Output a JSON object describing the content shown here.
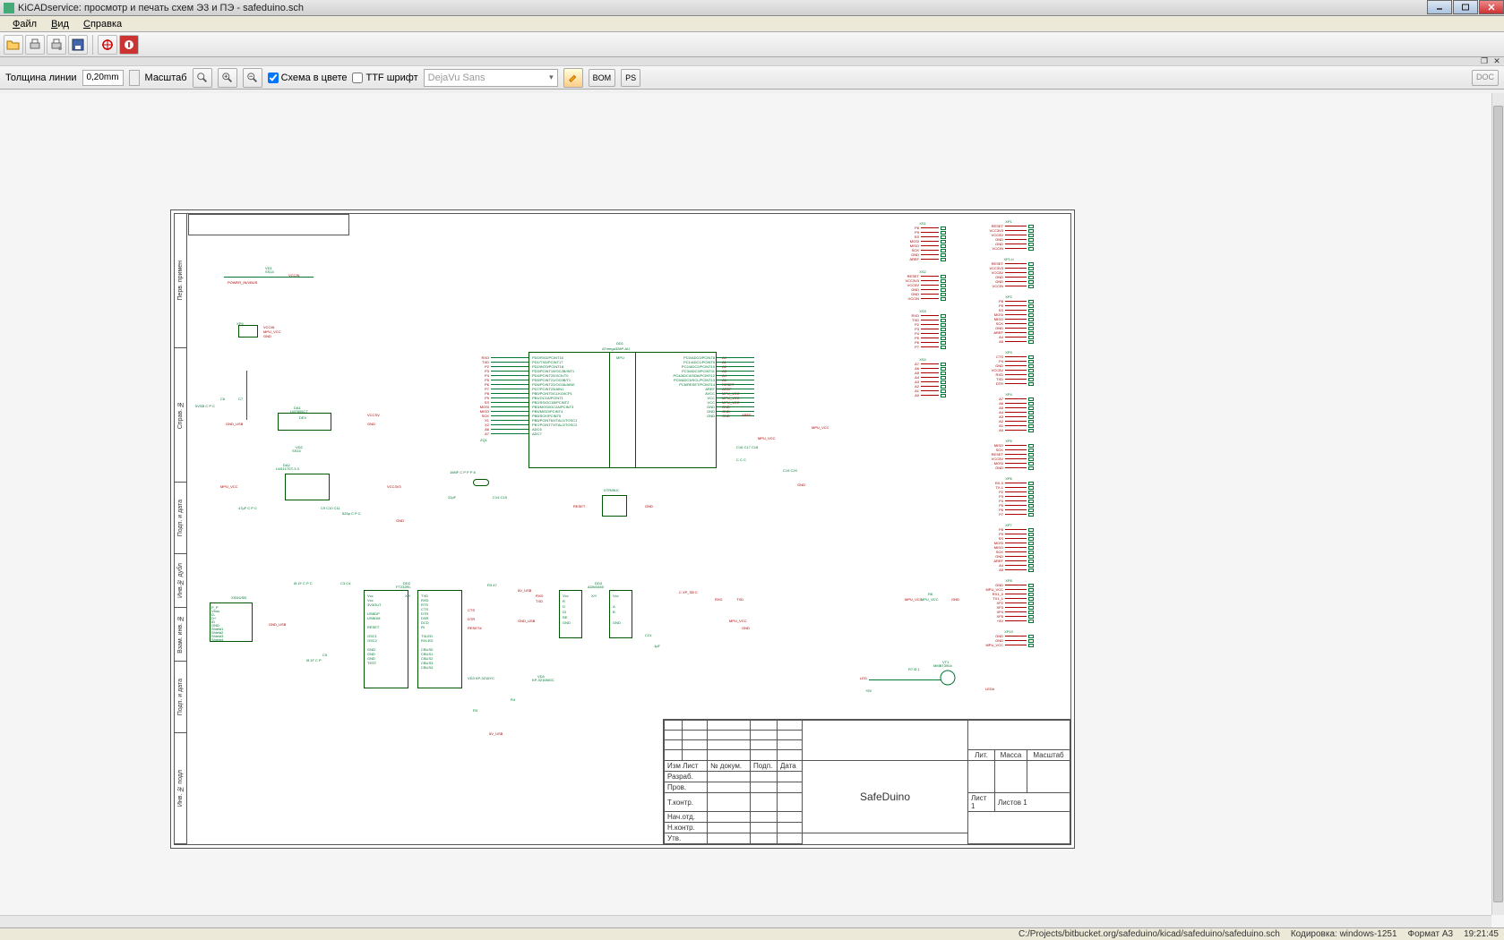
{
  "window": {
    "title": "KiCADservice: просмотр и печать схем Э3 и ПЭ - safeduino.sch"
  },
  "menu": {
    "file": "Файл",
    "view": "Вид",
    "help": "Справка"
  },
  "toolbar": {
    "open": "open",
    "printer1": "print-preview",
    "printer2": "print-setup",
    "save": "save",
    "fit": "zoom-fit",
    "stop": "stop"
  },
  "options": {
    "line_width_label": "Толщина линии",
    "line_width_value": "0,20mm",
    "scale_label": "Масштаб",
    "color_scheme_label": "Схема в цвете",
    "color_scheme_checked": true,
    "ttf_label": "TTF шрифт",
    "ttf_checked": false,
    "font_selected": "DejaVu Sans",
    "bom": "BOM",
    "ps": "PS",
    "doc": "DOC"
  },
  "side_labels": [
    "Перв. примен",
    "Справ. №",
    "Подп. и дата",
    "Инв.№ дубл",
    "Взам. инв. №",
    "Подп. и дата",
    "Инв. № подл"
  ],
  "titleblock": {
    "project": "SafeDuino",
    "cols_top": [
      "Лит.",
      "Масса",
      "Масштаб"
    ],
    "rows_left": [
      "Изм Лист",
      "№ докум.",
      "Подп.",
      "Дата"
    ],
    "rows_bot": [
      "Разраб.",
      "Пров.",
      "Т.контр.",
      "Нач.отд.",
      "Н.контр.",
      "Утв."
    ],
    "sheet": "Лист 1",
    "sheets": "Листов 1"
  },
  "ic_main": {
    "ref": "DD1",
    "value": "ATmega328P-AU",
    "label": "MPU",
    "pins_left": [
      "PD0/RXD/PCINT16",
      "PD1/TXD/PCINT17",
      "PD2/INT0/PCINT18",
      "PD3/PCINT19/OC2B/INT1",
      "PD4/PCINT20/XCK/T0",
      "PD5/PCINT21/OC0B/T1",
      "PD6/PCINT22/OC0A/AIN0",
      "PD7/PCINT23/AIN1",
      "PB0/PCINT0/CLKO/ICP1",
      "PB1/OC1A/PCINT1",
      "PB2/SS/OC1B/PCINT2",
      "PB3/MOSI/OC2A/PCINT3",
      "PB4/MISO/PCINT4",
      "PB5/SCK/PCINT5",
      "PB6/PCINT6/XTAL1/TOSC1",
      "PB7/PCINT7/XTAL2/TOSC2",
      "ADC6",
      "ADC7"
    ],
    "pins_right": [
      "PC0/ADC0/PCINT8",
      "PC1/ADC1/PCINT9",
      "PC2/ADC2/PCINT10",
      "PC3/ADC3/PCINT11",
      "PC4/ADC4/SDA/PCINT12",
      "PC5/ADC5/SCL/PCINT13",
      "PC6/RESET/PCINT14",
      "AREF",
      "AVCC",
      "VCC",
      "VCC",
      "GND",
      "GND",
      "GND"
    ],
    "nets_left": [
      "RXD",
      "TXD",
      "P2",
      "P3",
      "P4",
      "P5",
      "P6",
      "P7",
      "P8",
      "P9",
      "SS",
      "MOSI",
      "MISO",
      "SCK",
      "X1",
      "X2",
      "A6",
      "A7"
    ],
    "nets_right": [
      "A0",
      "A1",
      "A2",
      "A3",
      "A4",
      "A5",
      "RESET",
      "AREF",
      "MPU_VCC",
      "MPU_VCC",
      "MPU_VCC",
      "GND",
      "GND",
      "GND"
    ]
  },
  "ic_usb": {
    "ref": "DD2",
    "value": "FT232RL",
    "label": "X/Y"
  },
  "ic_rs485": {
    "ref": "DD3",
    "value": "ADM3485",
    "label": "X/Y"
  },
  "reg1": {
    "ref": "DA1",
    "value": "LM7805CT",
    "label": "DEV"
  },
  "reg2": {
    "ref": "DA2",
    "value": "LM1117DT-3.3"
  },
  "diode1": {
    "ref": "VD1",
    "value": "SS14"
  },
  "diode2": {
    "ref": "VD2",
    "value": "SS14"
  },
  "led_circuit": {
    "ref": "VT1",
    "value": "MMBT3904",
    "r": "R7 Ø.1",
    "label": "LED",
    "label2": "LED#"
  },
  "status": {
    "path": "C:/Projects/bitbucket.org/safeduino/kicad/safeduino/safeduino.sch",
    "encoding": "Кодировка: windows-1251",
    "format": "Формат A3",
    "time": "19:21:45"
  },
  "headers_right": [
    {
      "ref": "XP1",
      "pins": [
        "RESET",
        "VCC3V3",
        "VCC5V",
        "GND",
        "GND",
        "VCCIN"
      ]
    },
    {
      "ref": "XP1-b",
      "pins": [
        "RESET",
        "VCC3V3",
        "VCC5V",
        "GND",
        "GND",
        "VCCIN"
      ]
    },
    {
      "ref": "XP2",
      "pins": [
        "P8",
        "P9",
        "SS",
        "MOSI",
        "MISO",
        "SCK",
        "GND",
        "AREF",
        "A4",
        "A5"
      ]
    },
    {
      "ref": "XP3",
      "pins": [
        "CTS",
        "P4",
        "GND",
        "VCC5V",
        "RXD",
        "TXD",
        "DTR"
      ]
    },
    {
      "ref": "XP4",
      "pins": [
        "A7",
        "A6",
        "A5",
        "A4",
        "A3",
        "A2",
        "A1",
        "A0"
      ]
    },
    {
      "ref": "XP5",
      "pins": [
        "MISO",
        "SCK",
        "RESET",
        "VCC5V",
        "MOSI",
        "GND"
      ]
    },
    {
      "ref": "XP6",
      "pins": [
        "RX-0",
        "TX-1",
        "P2",
        "P3",
        "P4",
        "P5",
        "P6",
        "P7"
      ]
    },
    {
      "ref": "XP7",
      "pins": [
        "P8",
        "P9",
        "SS",
        "MOSI",
        "MISO",
        "SCK",
        "GND",
        "AREF",
        "A4",
        "A5"
      ]
    },
    {
      "ref": "XP8",
      "pins": [
        "GND",
        "MPU_VCC",
        "RX1_0",
        "TX1_1",
        "XP2",
        "XP3",
        "XP4",
        "XP5",
        "+5V"
      ]
    },
    {
      "ref": "XP10",
      "pins": [
        "GND",
        "GND",
        "MPU_VCC"
      ]
    }
  ],
  "headers_mid": [
    {
      "ref": "XS1",
      "pins": [
        "P8",
        "P9",
        "SS",
        "MOSI",
        "MISO",
        "SCK",
        "GND",
        "AREF"
      ]
    },
    {
      "ref": "XS2",
      "pins": [
        "RESET",
        "VCC3V3",
        "VCC5V",
        "GND",
        "GND",
        "VCCIN"
      ]
    },
    {
      "ref": "XS3",
      "pins": [
        "RXD",
        "TXD",
        "P2",
        "P3",
        "P4",
        "P5",
        "P6",
        "P7"
      ]
    },
    {
      "ref": "XS4",
      "pins": [
        "A7",
        "A6",
        "A5",
        "A4",
        "A3",
        "A2",
        "A1",
        "A0"
      ]
    }
  ],
  "usb_conn": {
    "ref": "XS5",
    "label": "USB",
    "pins": [
      "P_P",
      "Vbus",
      "D-",
      "D+",
      "ID",
      "GND",
      "Shield1",
      "Shield2",
      "Shield3",
      "Shield4"
    ]
  }
}
